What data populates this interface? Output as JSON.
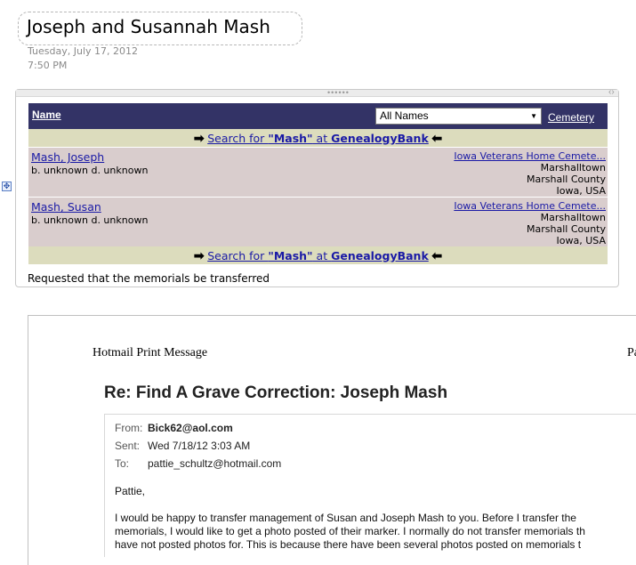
{
  "note": {
    "title": "Joseph and Susannah Mash",
    "date": "Tuesday, July 17, 2012",
    "time": "7:50 PM"
  },
  "findagrave": {
    "header": {
      "name_label": "Name",
      "filter_value": "All Names",
      "cemetery_label": "Cemetery"
    },
    "search_link": {
      "prefix": "Search for ",
      "surname": "\"Mash\"",
      "middle": " at ",
      "site": "GenealogyBank"
    },
    "rows": [
      {
        "name": "Mash, Joseph",
        "dates": "b. unknown d. unknown",
        "cemetery": "Iowa Veterans Home Cemete...",
        "city": "Marshalltown",
        "county": "Marshall County",
        "state": "Iowa, USA"
      },
      {
        "name": "Mash, Susan",
        "dates": "b. unknown d. unknown",
        "cemetery": "Iowa Veterans Home Cemete...",
        "city": "Marshalltown",
        "county": "Marshall County",
        "state": "Iowa, USA"
      }
    ],
    "note_text": "Requested that the memorials be transferred"
  },
  "printout": {
    "header_left": "Hotmail Print Message",
    "header_right": "Pa",
    "subject": "Re: Find A Grave Correction: Joseph Mash",
    "from_label": "From:",
    "from_value": "Bick62@aol.com",
    "sent_label": "Sent:",
    "sent_value": "Wed 7/18/12 3:03 AM",
    "to_label": "To:",
    "to_value": "pattie_schultz@hotmail.com",
    "greeting": "Pattie,",
    "body_line1": "I would be happy to transfer management of Susan and Joseph Mash to you.  Before I transfer the",
    "body_line2": "memorials, I would like to get a photo posted of their marker.  I normally do not transfer memorials th",
    "body_line3": "have not posted photos for.  This is because there have been several photos posted on memorials t"
  },
  "icons": {
    "arrow_right": "➡",
    "arrow_left": "⬅",
    "move_handle": "✥"
  }
}
